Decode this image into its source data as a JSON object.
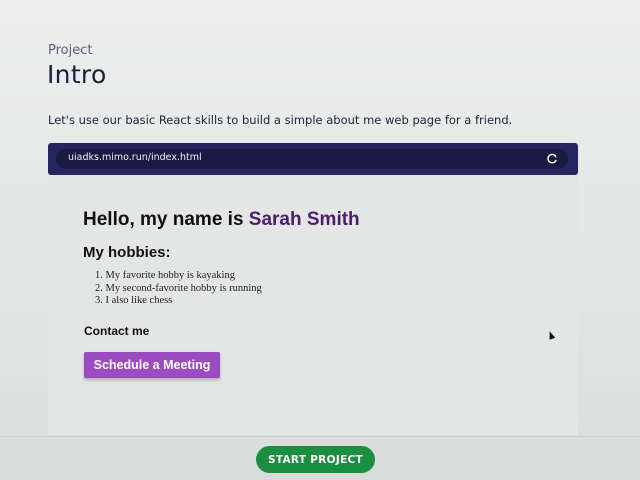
{
  "header": {
    "eyebrow": "Project",
    "title": "Intro",
    "description": "Let's use our basic React skills to build a simple about me web page for a friend."
  },
  "browser": {
    "url": "uiadks.mimo.run/index.html",
    "reload_icon": "reload-icon"
  },
  "preview": {
    "greeting_prefix": "Hello, my name is ",
    "name": "Sarah Smith",
    "name_color": "#4c1d6b",
    "hobbies_heading": "My hobbies:",
    "hobbies": [
      "1. My favorite hobby is kayaking",
      "2. My second-favorite hobby is running",
      "3. I also like chess"
    ],
    "contact_label": "Contact me",
    "meeting_button": "Schedule a Meeting",
    "meeting_button_color": "#9a4cc0"
  },
  "footer": {
    "start_button": "START PROJECT",
    "start_button_color": "#1b8e3f"
  }
}
